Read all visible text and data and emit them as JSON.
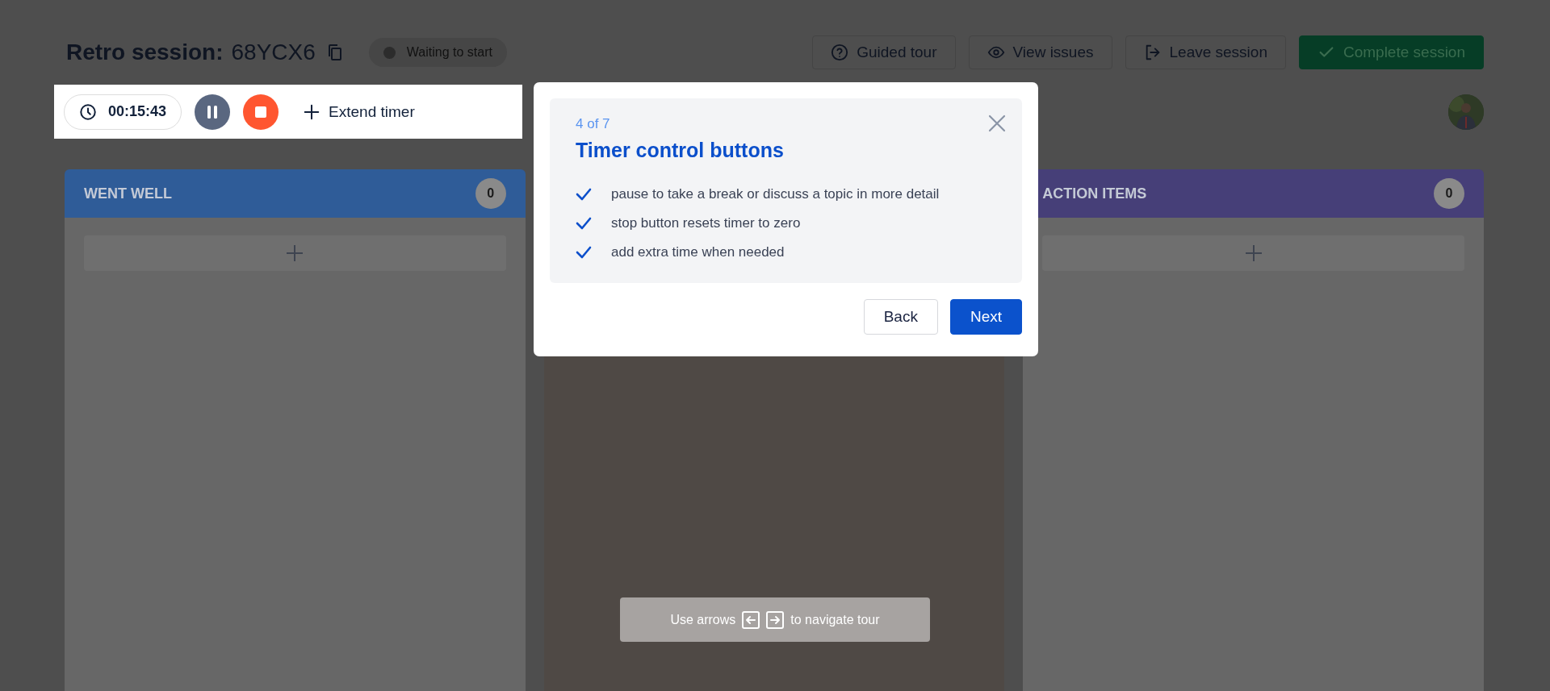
{
  "header": {
    "title": "Retro session:",
    "code": "68YCX6",
    "status": "Waiting to start",
    "buttons": [
      {
        "kind": "help",
        "label": "Guided tour"
      },
      {
        "kind": "view",
        "label": "View issues"
      },
      {
        "kind": "leave",
        "label": "Leave session"
      },
      {
        "kind": "complete",
        "label": "Complete session"
      }
    ]
  },
  "timer": {
    "time": "00:15:43",
    "extend": "Extend timer"
  },
  "columns": [
    {
      "title": "WENT WELL",
      "count": "0",
      "color": "#2f5c98"
    },
    {
      "color": "#4f4945"
    },
    {
      "title": "ACTION ITEMS",
      "count": "0",
      "color": "#463f78"
    }
  ],
  "tour": {
    "step": "4 of 7",
    "title": "Timer control buttons",
    "points": [
      "pause to take a break or discuss a topic in more detail",
      "stop button resets timer to zero",
      "add extra time when needed"
    ],
    "buttons": [
      {
        "kind": "secondary",
        "label": "Back"
      },
      {
        "kind": "primary",
        "label": "Next"
      }
    ]
  },
  "hint": {
    "before": "Use arrows",
    "after": "to navigate tour"
  }
}
